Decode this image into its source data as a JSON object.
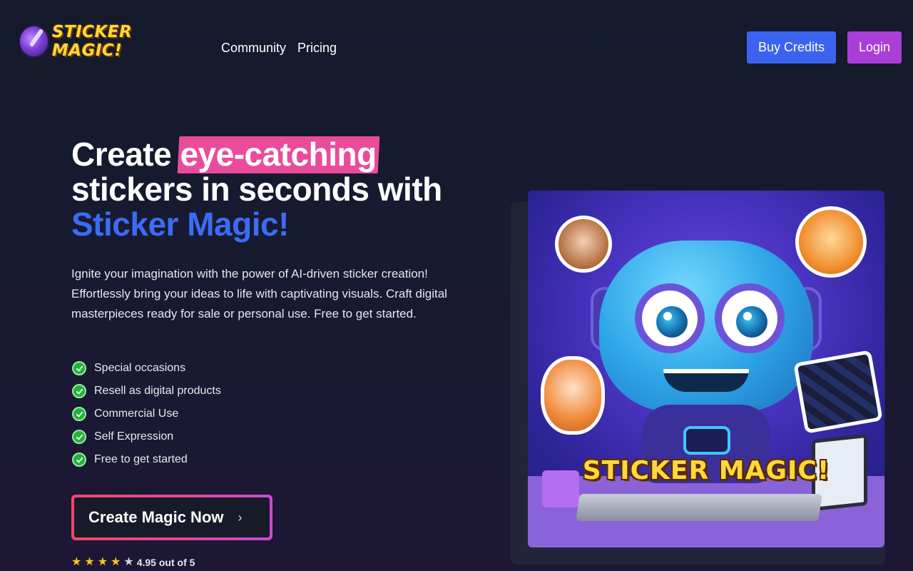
{
  "header": {
    "logo_text": "STICKER MAGIC!",
    "nav": [
      {
        "label": "Community"
      },
      {
        "label": "Pricing"
      }
    ],
    "buy_credits_label": "Buy Credits",
    "login_label": "Login"
  },
  "hero": {
    "title_part1": "Create ",
    "title_highlight": "eye-catching",
    "title_part2": " stickers in seconds with ",
    "title_brand": "Sticker Magic!",
    "description": "Ignite your imagination with the power of AI-driven sticker creation! Effortlessly bring your ideas to life with captivating visuals. Craft digital masterpieces ready for sale or personal use. Free to get started.",
    "features": [
      {
        "label": "Special occasions"
      },
      {
        "label": "Resell as digital products"
      },
      {
        "label": "Commercial Use"
      },
      {
        "label": "Self Expression"
      },
      {
        "label": "Free to get started"
      }
    ],
    "cta_label": "Create Magic Now",
    "cta_arrow": "›",
    "rating": {
      "stars_filled": 4,
      "stars_total": 5,
      "text": "4.95 out of 5"
    }
  },
  "hero_image": {
    "caption": "STICKER MAGIC!"
  },
  "colors": {
    "accent_blue": "#3b63f0",
    "accent_purple": "#a93ed8",
    "highlight_pink": "#ea4c9b",
    "brand_blue": "#3b6cf5",
    "check_green": "#22b33a",
    "star_gold": "#f5c518"
  },
  "icons": {
    "logo": "wand-sticker-logo-icon",
    "feature_check": "check-circle-icon",
    "cta_arrow": "chevron-right-icon",
    "rating_star": "star-icon"
  }
}
